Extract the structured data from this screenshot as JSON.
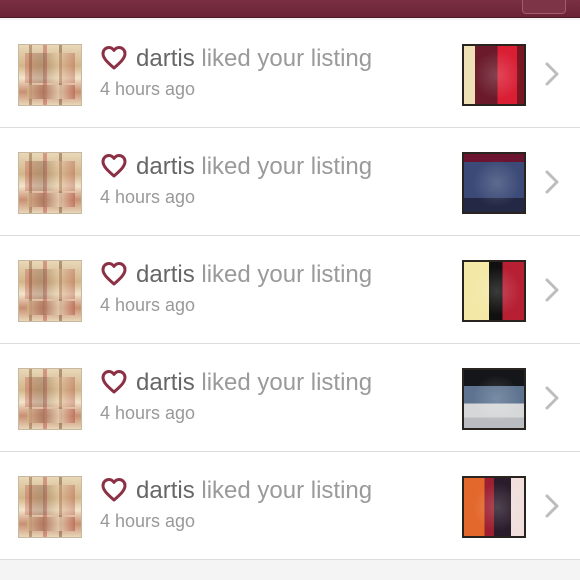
{
  "colors": {
    "accent": "#8b3045",
    "top_bar": "#722a3d",
    "username_text": "#666666",
    "secondary_text": "#999999"
  },
  "notifications": [
    {
      "username": "dartis",
      "action": "liked your listing",
      "time": "4 hours ago",
      "icon": "heart-icon",
      "listing_image": "red-garment-thumbnail"
    },
    {
      "username": "dartis",
      "action": "liked your listing",
      "time": "4 hours ago",
      "icon": "heart-icon",
      "listing_image": "blue-sweatshirt-thumbnail"
    },
    {
      "username": "dartis",
      "action": "liked your listing",
      "time": "4 hours ago",
      "icon": "heart-icon",
      "listing_image": "black-dress-thumbnail"
    },
    {
      "username": "dartis",
      "action": "liked your listing",
      "time": "4 hours ago",
      "icon": "heart-icon",
      "listing_image": "denim-skirt-thumbnail"
    },
    {
      "username": "dartis",
      "action": "liked your listing",
      "time": "4 hours ago",
      "icon": "heart-icon",
      "listing_image": "patterned-dress-thumbnail"
    }
  ]
}
